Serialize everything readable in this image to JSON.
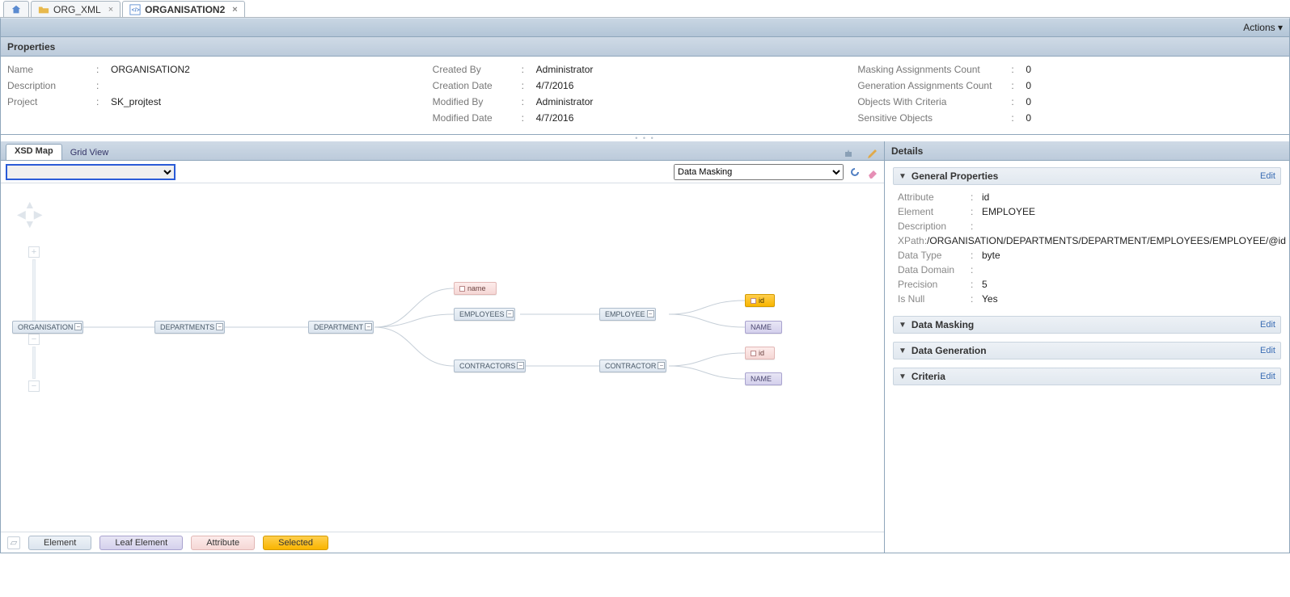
{
  "tabs": {
    "orgxml": "ORG_XML",
    "active": "ORGANISATION2"
  },
  "actions": {
    "label": "Actions"
  },
  "properties": {
    "title": "Properties",
    "col1": {
      "name_l": "Name",
      "name_v": "ORGANISATION2",
      "desc_l": "Description",
      "proj_l": "Project",
      "proj_v": "SK_projtest"
    },
    "col2": {
      "cby_l": "Created By",
      "cby_v": "Administrator",
      "cdt_l": "Creation Date",
      "cdt_v": "4/7/2016",
      "mby_l": "Modified By",
      "mby_v": "Administrator",
      "mdt_l": "Modified Date",
      "mdt_v": "4/7/2016"
    },
    "col3": {
      "mac_l": "Masking Assignments Count",
      "mac_v": "0",
      "gac_l": "Generation Assignments Count",
      "gac_v": "0",
      "owc_l": "Objects With Criteria",
      "owc_v": "0",
      "so_l": "Sensitive Objects",
      "so_v": "0"
    }
  },
  "views": {
    "xsd": "XSD Map",
    "grid": "Grid View"
  },
  "toolbar": {
    "mode": "Data Masking"
  },
  "nodes": {
    "org": "ORGANISATION",
    "depts": "DEPARTMENTS",
    "dept": "DEPARTMENT",
    "name": "name",
    "emps": "EMPLOYEES",
    "emp": "EMPLOYEE",
    "contrs": "CONTRACTORS",
    "contr": "CONTRACTOR",
    "id": "id",
    "NAME": "NAME"
  },
  "legend": {
    "elem": "Element",
    "leaf": "Leaf Element",
    "attr": "Attribute",
    "sel": "Selected"
  },
  "details": {
    "title": "Details",
    "sec_gen": "General Properties",
    "sec_mask": "Data Masking",
    "sec_gen2": "Data Generation",
    "sec_crit": "Criteria",
    "edit": "Edit",
    "kv": {
      "attr_l": "Attribute",
      "attr_v": "id",
      "elem_l": "Element",
      "elem_v": "EMPLOYEE",
      "desc_l": "Description",
      "desc_v": "",
      "xp_l": "XPath",
      "xp_v": "/ORGANISATION/DEPARTMENTS/DEPARTMENT/EMPLOYEES/EMPLOYEE/@id",
      "dt_l": "Data Type",
      "dt_v": "byte",
      "dd_l": "Data Domain",
      "dd_v": "",
      "pr_l": "Precision",
      "pr_v": "5",
      "nul_l": "Is Null",
      "nul_v": "Yes"
    }
  }
}
